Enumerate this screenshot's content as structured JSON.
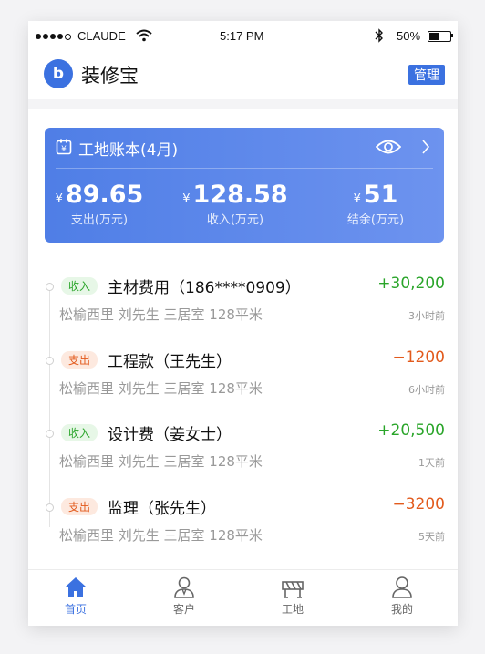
{
  "status_bar": {
    "carrier": "CLAUDE",
    "time": "5:17 PM",
    "battery_percent": "50%",
    "battery_level": 0.5
  },
  "header": {
    "logo_text": "b",
    "title": "装修宝",
    "manage_label": "管理"
  },
  "summary_card": {
    "title": "工地账本(4月)",
    "stats": [
      {
        "currency": "¥",
        "value": "89.65",
        "label": "支出(万元)"
      },
      {
        "currency": "¥",
        "value": "128.58",
        "label": "收入(万元)"
      },
      {
        "currency": "¥",
        "value": "51",
        "label": "结余(万元)"
      }
    ]
  },
  "records": [
    {
      "type": "in",
      "badge": "收入",
      "title": "主材费用（186****0909）",
      "amount": "+30,200",
      "subtitle": "松榆西里 刘先生 三居室 128平米",
      "time": "3小时前"
    },
    {
      "type": "out",
      "badge": "支出",
      "title": "工程款（王先生）",
      "amount": "−1200",
      "subtitle": "松榆西里 刘先生 三居室 128平米",
      "time": "6小时前"
    },
    {
      "type": "in",
      "badge": "收入",
      "title": "设计费（姜女士）",
      "amount": "+20,500",
      "subtitle": "松榆西里 刘先生 三居室 128平米",
      "time": "1天前"
    },
    {
      "type": "out",
      "badge": "支出",
      "title": "监理（张先生）",
      "amount": "−3200",
      "subtitle": "松榆西里 刘先生 三居室 128平米",
      "time": "5天前"
    }
  ],
  "tabbar": {
    "items": [
      {
        "label": "首页",
        "icon": "home-icon",
        "active": true
      },
      {
        "label": "客户",
        "icon": "customer-icon",
        "active": false
      },
      {
        "label": "工地",
        "icon": "construction-site-icon",
        "active": false
      },
      {
        "label": "我的",
        "icon": "profile-icon",
        "active": false
      }
    ]
  },
  "colors": {
    "accent": "#3b71e0",
    "income": "#2aa52a",
    "expense": "#e25a1c"
  }
}
